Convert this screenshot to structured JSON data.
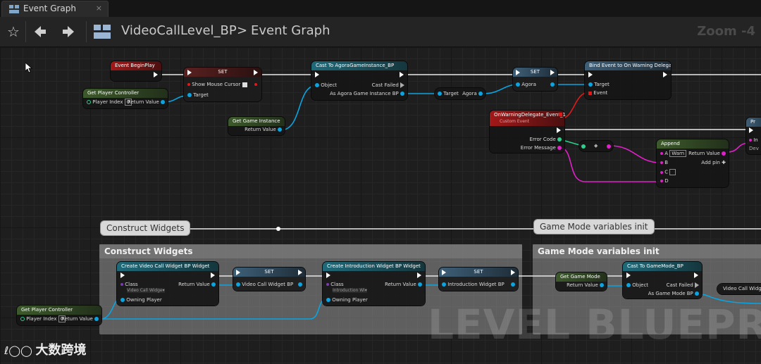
{
  "tab": {
    "label": "Event Graph",
    "close": "×"
  },
  "toolbar": {
    "breadcrumb_root": "VideoCallLevel_BP",
    "breadcrumb_sep": ">",
    "breadcrumb_current": "Event Graph",
    "zoom": "Zoom -4"
  },
  "nodes": {
    "begin_play": {
      "title": "Event BeginPlay"
    },
    "get_pc1": {
      "title": "Get Player Controller",
      "player_index": "Player Index",
      "idx": "0",
      "ret": "Return Value"
    },
    "set1": {
      "title": "SET",
      "show_mouse": "Show Mouse Cursor",
      "target": "Target"
    },
    "get_gi": {
      "title": "Get Game Instance",
      "ret": "Return Value"
    },
    "cast_gi": {
      "title": "Cast To AgoraGameInstance_BP",
      "object": "Object",
      "cast_failed": "Cast Failed",
      "as": "As Agora Game Instance BP"
    },
    "var_get": {
      "target": "Target",
      "agora": "Agora"
    },
    "set2": {
      "title": "SET",
      "agora": "Agora"
    },
    "bind": {
      "title": "Bind Event to On Warning Delegate",
      "target": "Target",
      "event": "Event"
    },
    "custom_event": {
      "title": "OnWarningDelegate_Event_1",
      "subtitle": "Custom Event",
      "error_code": "Error Code",
      "error_msg": "Error Message"
    },
    "conv": {
      "label": "◆"
    },
    "append": {
      "title": "Append",
      "a": "A",
      "a_val": "Warn",
      "b": "B",
      "c": "C",
      "d": "D",
      "ret": "Return Value",
      "add_pin": "Add pin"
    },
    "print": {
      "title": "Pr",
      "in": "In",
      "dev": "Dev"
    },
    "create1": {
      "title": "Create Video Call Widget BP Widget",
      "class": "Class",
      "class_val": "Video Call Widge▾",
      "owning": "Owning Player",
      "ret": "Return Value"
    },
    "set3": {
      "title": "SET",
      "var": "Video Call Widget BP"
    },
    "create2": {
      "title": "Create Introduction Widget BP Widget",
      "class": "Class",
      "class_val": "Introduction Wi▾",
      "owning": "Owning Player",
      "ret": "Return Value"
    },
    "set4": {
      "title": "SET",
      "var": "Introduction Widget BP"
    },
    "get_gm": {
      "title": "Get Game Mode",
      "ret": "Return Value"
    },
    "cast_gm": {
      "title": "Cast To GameMode_BP",
      "object": "Object",
      "cast_failed": "Cast Failed",
      "as": "As Game Mode BP"
    },
    "vcw": {
      "label": "Video Call Widget B"
    },
    "get_pc2": {
      "title": "Get Player Controller",
      "player_index": "Player Index",
      "idx": "0",
      "ret": "Return Value"
    }
  },
  "comments": {
    "construct_bubble": "Construct Widgets",
    "construct_title": "Construct Widgets",
    "gamemode_bubble": "Game Mode variables init",
    "gamemode_title": "Game Mode variables init"
  },
  "watermark": "LEVEL BLUEPRINT",
  "logo": "大数跨境"
}
